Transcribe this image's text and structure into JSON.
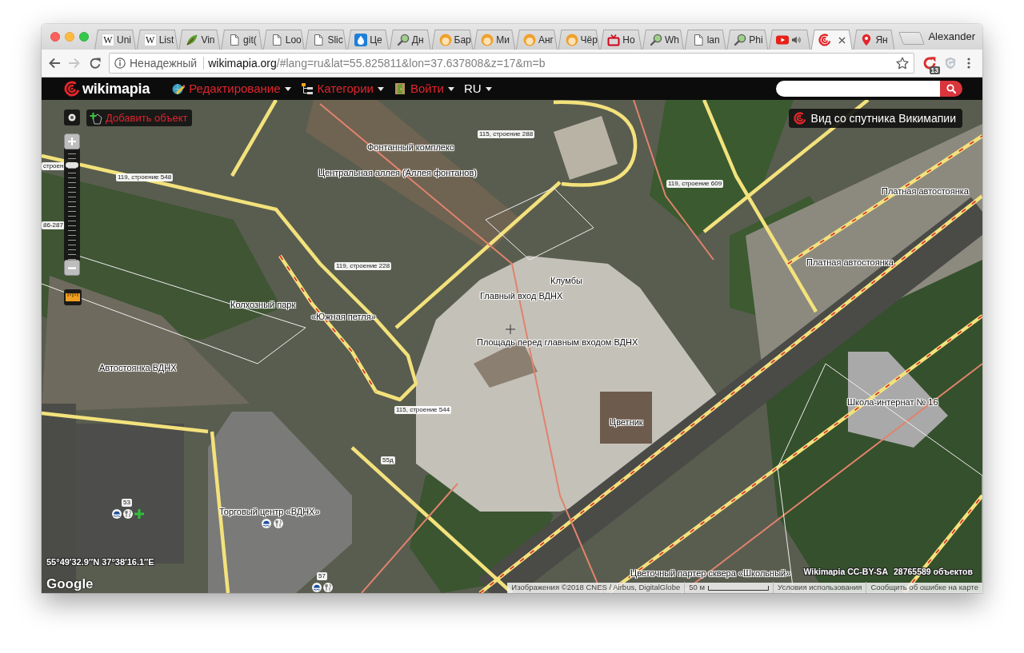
{
  "tabs": [
    {
      "kind": "letter",
      "favicon": "W",
      "label": "Uni",
      "audio": false,
      "selected": false
    },
    {
      "kind": "letter",
      "favicon": "W",
      "label": "List",
      "audio": false,
      "selected": false
    },
    {
      "kind": "leaf",
      "label": "Vin",
      "audio": false,
      "selected": false
    },
    {
      "kind": "page",
      "label": "git(",
      "audio": false,
      "selected": false
    },
    {
      "kind": "page",
      "label": "Loo",
      "audio": false,
      "selected": false
    },
    {
      "kind": "page",
      "label": "Slic",
      "audio": false,
      "selected": false
    },
    {
      "kind": "drop",
      "label": "Це",
      "audio": false,
      "selected": false
    },
    {
      "kind": "magnifier",
      "label": "Дн",
      "audio": false,
      "selected": false
    },
    {
      "kind": "avatar",
      "label": "Бар",
      "audio": false,
      "selected": false
    },
    {
      "kind": "avatar",
      "label": "Ми",
      "audio": false,
      "selected": false
    },
    {
      "kind": "avatar",
      "label": "Анг",
      "audio": false,
      "selected": false
    },
    {
      "kind": "avatar",
      "label": "Чёр",
      "audio": false,
      "selected": false
    },
    {
      "kind": "tv",
      "label": "Но",
      "audio": false,
      "selected": false
    },
    {
      "kind": "magnifier",
      "label": "Wh",
      "audio": false,
      "selected": false
    },
    {
      "kind": "page",
      "label": "lan",
      "audio": false,
      "selected": false
    },
    {
      "kind": "magnifier",
      "label": "Phi",
      "audio": false,
      "selected": false
    },
    {
      "kind": "play",
      "audio": true,
      "selected": false
    },
    {
      "kind": "swirl",
      "audio": false,
      "selected": true
    },
    {
      "kind": "pin",
      "label": "Ян",
      "audio": false,
      "selected": false
    }
  ],
  "profile": {
    "name": "Alexander"
  },
  "navigation": {
    "back_enabled": true,
    "forward_enabled": false
  },
  "address_bar": {
    "security_label": "Ненадежный",
    "host": "wikimapia.org",
    "path": "/#lang=ru&lat=55.825811&lon=37.637808&z=17&m=b",
    "bookmarked": false
  },
  "extensions": [
    {
      "kind": "reload",
      "badge": "13"
    },
    {
      "kind": "shield"
    }
  ],
  "site_header": {
    "logo_text": "wikimapia",
    "menus": [
      {
        "kind": "edit",
        "label": "Редактирование"
      },
      {
        "kind": "categories",
        "label": "Категории"
      },
      {
        "kind": "login",
        "label": "Войти"
      },
      {
        "kind": "language",
        "label": "RU"
      }
    ]
  },
  "map": {
    "add_object": "Добавить объект",
    "satellite_view": "Вид со спутника Викимапии",
    "zoom_slider": {
      "level": 0.88
    },
    "labels": [
      {
        "kind": "building",
        "text": "115, строение 288"
      },
      {
        "kind": "place",
        "text": "Фонтанный комплекс"
      },
      {
        "kind": "building",
        "text": "строен"
      },
      {
        "kind": "place",
        "text": "Центральная аллея (Аллея фонтанов)"
      },
      {
        "kind": "building",
        "text": "119, строение 548"
      },
      {
        "kind": "building",
        "text": "119, строение 609"
      },
      {
        "kind": "place",
        "text": "Платная автостоянка"
      },
      {
        "kind": "building",
        "text": "86-287"
      },
      {
        "kind": "place",
        "text": "Платная автостоянка"
      },
      {
        "kind": "building",
        "text": "119, строение 228"
      },
      {
        "kind": "place",
        "text": "Клумбы"
      },
      {
        "kind": "place",
        "text": "Главный вход ВДНХ"
      },
      {
        "kind": "place",
        "text": "Колхозный парк"
      },
      {
        "kind": "place",
        "text": "«Южная петля»"
      },
      {
        "kind": "place",
        "text": "Площадь перед главным входом ВДНХ"
      },
      {
        "kind": "place",
        "text": "Автостоянка ВДНХ"
      },
      {
        "kind": "place",
        "text": "Школа-интернат № 16"
      },
      {
        "kind": "building",
        "text": "115, строение 544"
      },
      {
        "kind": "place",
        "text": "Цветник"
      },
      {
        "kind": "building",
        "text": "55д"
      },
      {
        "kind": "building",
        "text": "53"
      },
      {
        "kind": "place",
        "text": "Торговый центр «ВДНХ»"
      },
      {
        "kind": "building",
        "text": "57"
      },
      {
        "kind": "place",
        "text": "Цветочный партер сквера «Школьный»"
      }
    ],
    "coordinates": "55°49′32.9″N 37°38′16.1″E",
    "map_provider": "Google",
    "license": "Wikimapia CC-BY-SA",
    "object_count": "28765589 объектов",
    "footer": {
      "imagery_credit": "Изображения ©2018 CNES / Airbus, DigitalGlobe",
      "scale": "50 м",
      "terms": "Условия использования",
      "report_error": "Сообщить об ошибке на карте"
    }
  }
}
